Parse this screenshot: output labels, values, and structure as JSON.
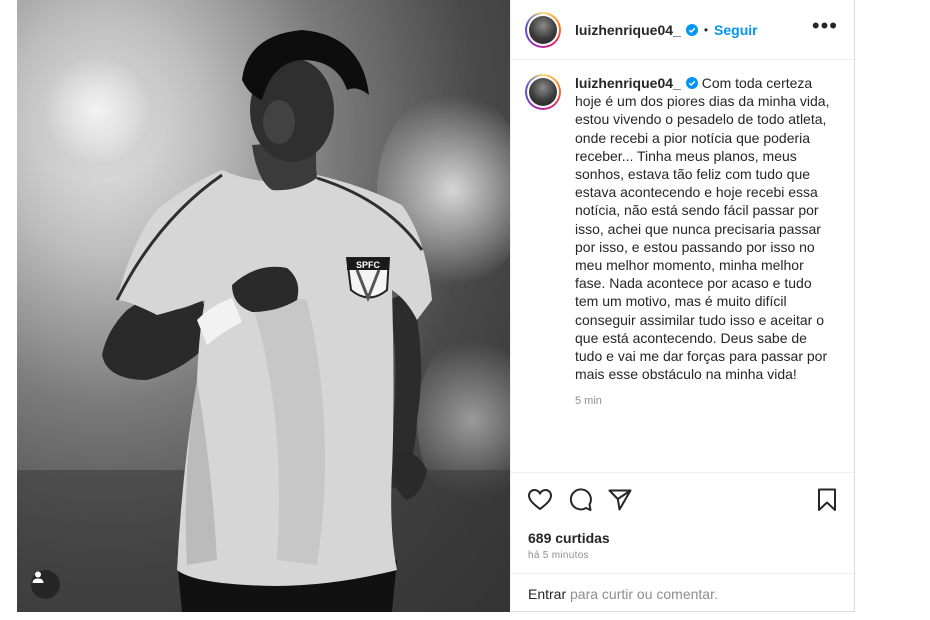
{
  "post": {
    "author": {
      "username": "luizhenrique04_",
      "follow_label": "Seguir",
      "separator": "•"
    },
    "photo": {
      "badge_text": "SPFC"
    },
    "caption": {
      "username": "luizhenrique04_",
      "text": "Com toda certeza hoje é um dos piores dias da minha vida, estou vivendo o pesadelo de todo atleta, onde recebi a pior notícia que poderia receber... Tinha meus planos, meus sonhos, estava tão feliz com tudo que estava acontecendo e hoje recebi essa notícia, não está sendo fácil passar por isso, achei que nunca precisaria passar por isso, e estou passando por isso no meu melhor momento, minha melhor fase. Nada acontece por acaso e tudo tem um motivo, mas é muito difícil conseguir assimilar tudo isso e aceitar o que está acontecendo. Deus sabe de tudo e vai me dar forças para passar por mais esse obstáculo na minha vida!",
      "time": "5 min"
    },
    "actions": {
      "icons": [
        "heart-icon",
        "comment-icon",
        "share-icon",
        "bookmark-icon"
      ]
    },
    "likes": "689 curtidas",
    "date": "há 5 minutos",
    "comment": {
      "login_label": "Entrar",
      "prompt": "para curtir ou comentar."
    },
    "colors": {
      "accent": "#0095f6",
      "text": "#262626",
      "muted": "#8e8e8e",
      "border": "#efefef"
    }
  }
}
